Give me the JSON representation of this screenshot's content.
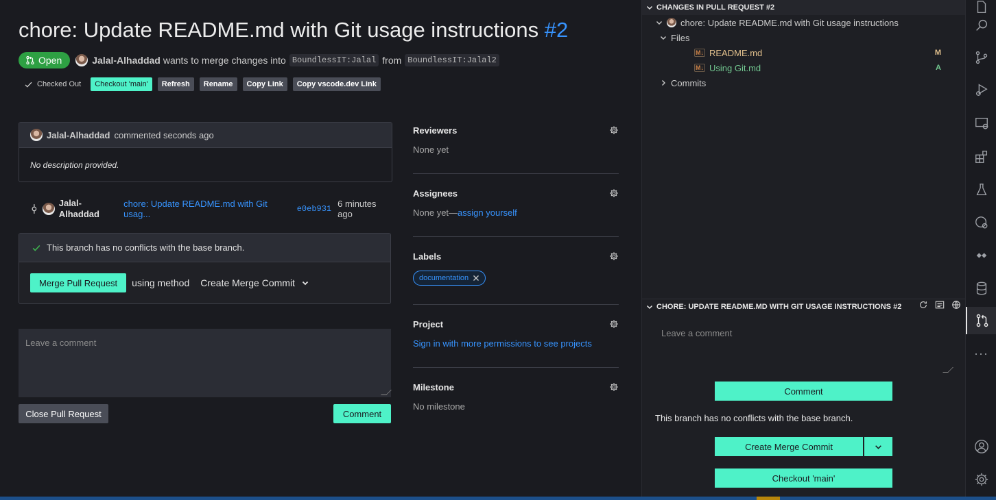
{
  "pr": {
    "title": "chore: Update README.md with Git usage instructions",
    "number": "#2",
    "status": "Open",
    "author": "Jalal-Alhaddad",
    "merge_text": "wants to merge changes into",
    "target_branch": "BoundlessIT:Jalal",
    "from_text": "from",
    "source_branch": "BoundlessIT:Jalal2"
  },
  "actions": {
    "checked_out": "Checked Out",
    "checkout_main": "Checkout 'main'",
    "refresh": "Refresh",
    "rename": "Rename",
    "copy_link": "Copy Link",
    "copy_vscode_link": "Copy vscode.dev Link"
  },
  "comment": {
    "author": "Jalal-Alhaddad",
    "time": "commented seconds ago",
    "body": "No description provided."
  },
  "commit": {
    "author_line1": "Jalal-",
    "author_line2": "Alhaddad",
    "message": "chore: Update README.md with Git usag...",
    "sha": "e0eb931",
    "time": "6 minutes ago"
  },
  "merge": {
    "status": "This branch has no conflicts with the base branch.",
    "button": "Merge Pull Request",
    "using_method": "using method",
    "method": "Create Merge Commit"
  },
  "compose": {
    "placeholder": "Leave a comment",
    "close_button": "Close Pull Request",
    "comment_button": "Comment"
  },
  "sidebar": {
    "reviewers": {
      "title": "Reviewers",
      "value": "None yet"
    },
    "assignees": {
      "title": "Assignees",
      "value": "None yet—",
      "link": "assign yourself"
    },
    "labels": {
      "title": "Labels",
      "label": "documentation"
    },
    "project": {
      "title": "Project",
      "link": "Sign in with more permissions to see projects"
    },
    "milestone": {
      "title": "Milestone",
      "value": "No milestone"
    }
  },
  "changes_panel": {
    "header": "CHANGES IN PULL REQUEST #2",
    "pr_item": "chore: Update README.md with Git usage instructions",
    "files_folder": "Files",
    "files": [
      {
        "name": "README.md",
        "status": "M",
        "color": "#e2c08d"
      },
      {
        "name": "Using Git.md",
        "status": "A",
        "color": "#73c991"
      }
    ],
    "commits_folder": "Commits"
  },
  "pr_panel": {
    "header": "CHORE: UPDATE README.MD WITH GIT USAGE INSTRUCTIONS #2",
    "placeholder": "Leave a comment",
    "comment_button": "Comment",
    "status": "This branch has no conflicts with the base branch.",
    "merge_button": "Create Merge Commit",
    "checkout_button": "Checkout 'main'"
  },
  "colors": {
    "accent": "#4ef2c8",
    "link": "#3794ff",
    "open_badge": "#2ea043"
  }
}
